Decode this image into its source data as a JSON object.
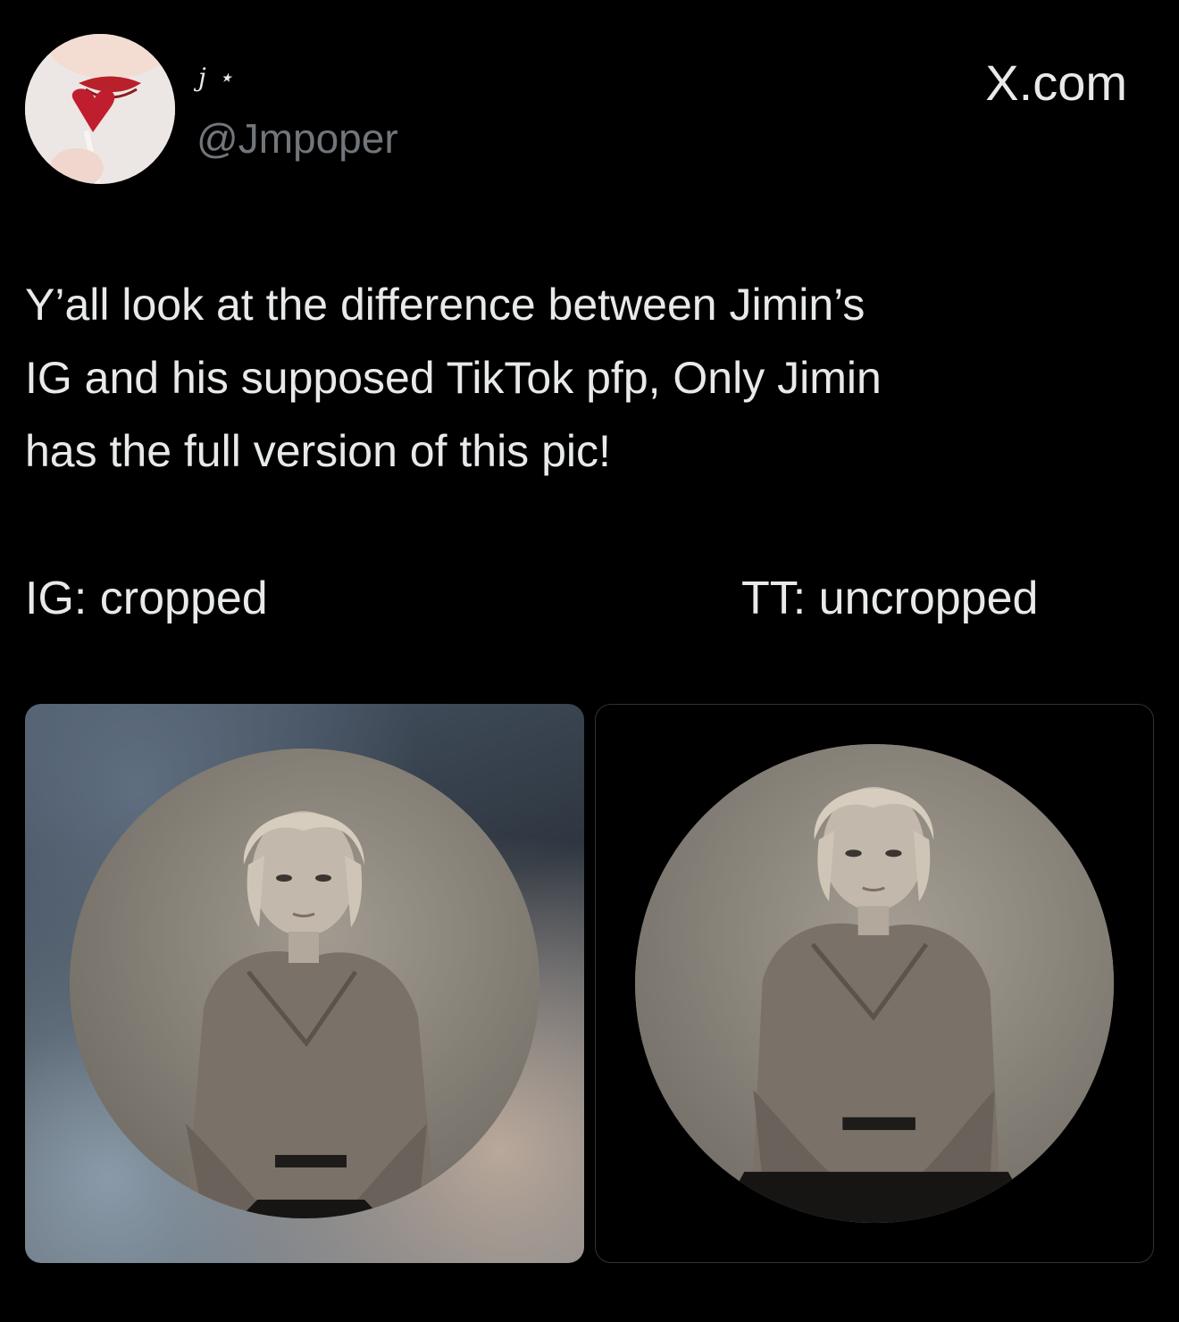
{
  "author": {
    "display_name": "j ⋆",
    "handle": "@Jmpoper",
    "avatar_icon": "profile-avatar-icon"
  },
  "brand": {
    "label": "X.com"
  },
  "tweet": {
    "text": "Y’all look at the difference between Jimin’s\nIG and his supposed TikTok pfp, Only Jimin\nhas the full version of this pic!"
  },
  "comparison": {
    "left_caption": "IG: cropped",
    "right_caption": "TT: uncropped"
  },
  "colors": {
    "background": "#000000",
    "text": "#e7e9ea",
    "muted": "#71767b",
    "border": "#2f3336"
  }
}
